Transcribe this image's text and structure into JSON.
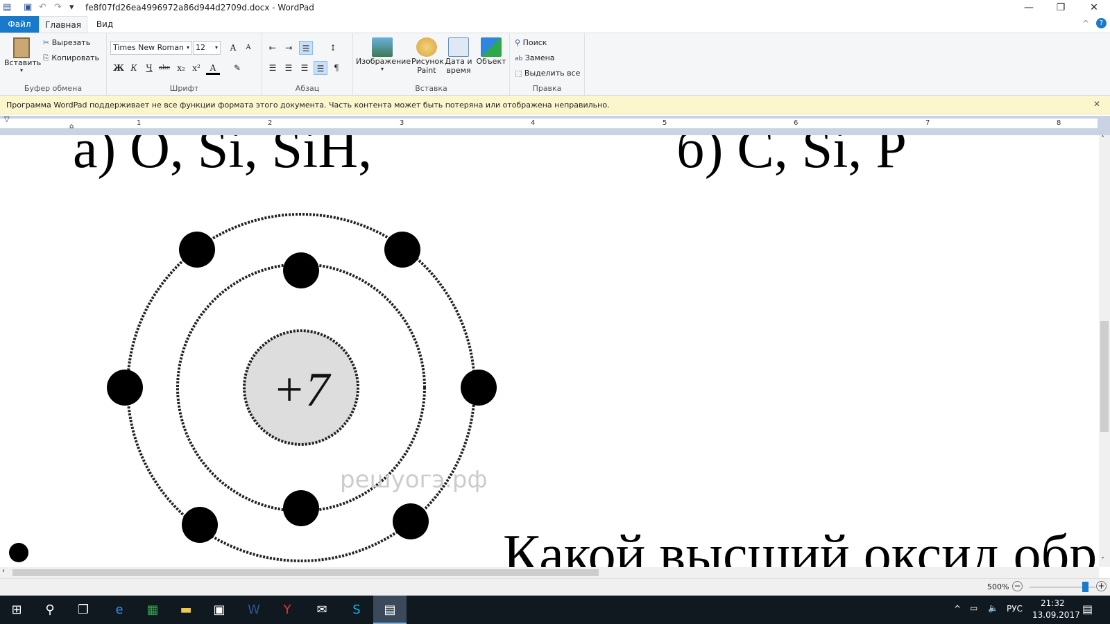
{
  "window": {
    "title": "fe8f07fd26ea4996972a86d944d2709d.docx - WordPad",
    "minimize": "—",
    "restore": "❐",
    "close": "✕"
  },
  "quick_access": {
    "customize": "▾"
  },
  "tabs": [
    {
      "label": "Файл"
    },
    {
      "label": "Главная"
    },
    {
      "label": "Вид"
    }
  ],
  "ribbon": {
    "clipboard": {
      "label": "Буфер обмена",
      "paste": "Вставить",
      "cut": "Вырезать",
      "copy": "Копировать"
    },
    "font": {
      "label": "Шрифт",
      "family": "Times New Roman",
      "size": "12",
      "grow": "A",
      "shrink": "A",
      "bold": "Ж",
      "italic": "К",
      "underline": "Ч",
      "strike": "abc",
      "sub": "x₂",
      "sup": "x²",
      "color": "A",
      "highlight": "✎"
    },
    "paragraph": {
      "label": "Абзац"
    },
    "insert": {
      "label": "Вставка",
      "image": "Изображение",
      "paint_line1": "Рисунок",
      "paint_line2": "Paint",
      "datetime_line1": "Дата и",
      "datetime_line2": "время",
      "object": "Объект"
    },
    "editing": {
      "label": "Правка",
      "find": "Поиск",
      "replace": "Замена",
      "select_all": "Выделить все"
    }
  },
  "notification": {
    "text": "Программа WordPad поддерживает не все функции формата этого документа. Часть контента может быть потеряна или отображена неправильно.",
    "close": "✕"
  },
  "ruler": {
    "numbers": [
      "1",
      "2",
      "3",
      "4",
      "5",
      "6",
      "7",
      "8"
    ]
  },
  "document": {
    "line_top_left": "а) О, Si, SiH,",
    "line_top_right": "б) С, Si, Р",
    "nucleus": "+7",
    "watermark": "решуогэ.рф",
    "question": "Какой высший оксид обр"
  },
  "status": {
    "zoom": "500%",
    "zoom_level_percent": 500
  },
  "taskbar": {
    "lang": "РУС",
    "time": "21:32",
    "date": "13.09.2017"
  },
  "colors": {
    "accent": "#1979ca",
    "notification_bg": "#fcf6cd",
    "taskbar": "#101820"
  }
}
